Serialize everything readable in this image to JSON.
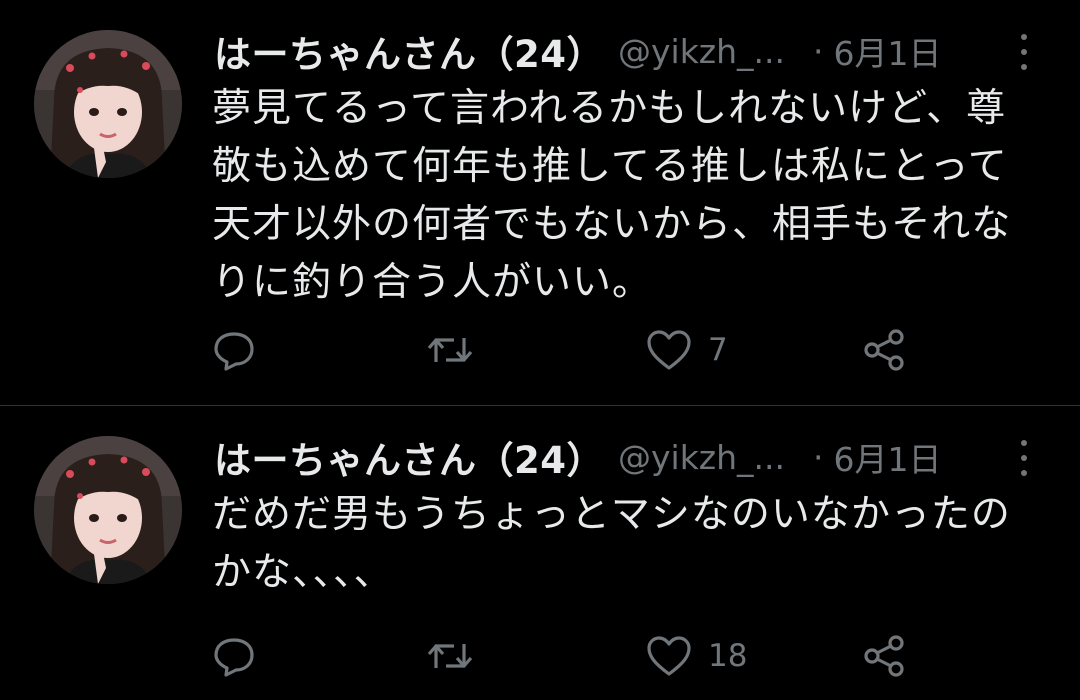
{
  "tweets": [
    {
      "display_name": "はーちゃんさん（24）",
      "handle": "@yikzh_...",
      "separator": "·",
      "date": "6月1日",
      "text": "夢見てるって言われるかもしれないけど、尊敬も込めて何年も推してる推しは私にとって天才以外の何者でもないから、相手もそれなりに釣り合う人がいい。",
      "reply_count": "",
      "retweet_count": "",
      "like_count": "7"
    },
    {
      "display_name": "はーちゃんさん（24）",
      "handle": "@yikzh_...",
      "separator": "·",
      "date": "6月1日",
      "text": "だめだ男もうちょっとマシなのいなかったのかな、、、、",
      "reply_count": "",
      "retweet_count": "",
      "like_count": "18"
    }
  ],
  "colors": {
    "background": "#000000",
    "primary_text": "#e7e9ea",
    "secondary_text": "#71767b",
    "divider": "#2f3336"
  },
  "icons": [
    "reply-icon",
    "retweet-icon",
    "like-icon",
    "share-icon",
    "more-options-icon",
    "avatar"
  ]
}
